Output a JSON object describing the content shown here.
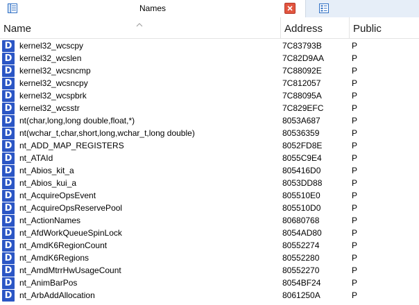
{
  "window": {
    "title": "Names"
  },
  "columns": {
    "name": "Name",
    "address": "Address",
    "public": "Public"
  },
  "icons": {
    "row_icon_letter": "D",
    "row_icon_color": "#2b56c5",
    "close_color": "#e2553f"
  },
  "rows": [
    {
      "name": "kernel32_wcscpy",
      "address": "7C83793B",
      "public": "P"
    },
    {
      "name": "kernel32_wcslen",
      "address": "7C82D9AA",
      "public": "P"
    },
    {
      "name": "kernel32_wcsncmp",
      "address": "7C88092E",
      "public": "P"
    },
    {
      "name": "kernel32_wcsncpy",
      "address": "7C812057",
      "public": "P"
    },
    {
      "name": "kernel32_wcspbrk",
      "address": "7C88095A",
      "public": "P"
    },
    {
      "name": "kernel32_wcsstr",
      "address": "7C829EFC",
      "public": "P"
    },
    {
      "name": "nt(char,long,long double,float,*)",
      "address": "8053A687",
      "public": "P"
    },
    {
      "name": "nt(wchar_t,char,short,long,wchar_t,long double)",
      "address": "80536359",
      "public": "P"
    },
    {
      "name": "nt_ADD_MAP_REGISTERS",
      "address": "8052FD8E",
      "public": "P"
    },
    {
      "name": "nt_ATAId",
      "address": "8055C9E4",
      "public": "P"
    },
    {
      "name": "nt_Abios_kit_a",
      "address": "805416D0",
      "public": "P"
    },
    {
      "name": "nt_Abios_kui_a",
      "address": "8053DD88",
      "public": "P"
    },
    {
      "name": "nt_AcquireOpsEvent",
      "address": "805510E0",
      "public": "P"
    },
    {
      "name": "nt_AcquireOpsReservePool",
      "address": "805510D0",
      "public": "P"
    },
    {
      "name": "nt_ActionNames",
      "address": "80680768",
      "public": "P"
    },
    {
      "name": "nt_AfdWorkQueueSpinLock",
      "address": "8054AD80",
      "public": "P"
    },
    {
      "name": "nt_AmdK6RegionCount",
      "address": "80552274",
      "public": "P"
    },
    {
      "name": "nt_AmdK6Regions",
      "address": "80552280",
      "public": "P"
    },
    {
      "name": "nt_AmdMtrrHwUsageCount",
      "address": "80552270",
      "public": "P"
    },
    {
      "name": "nt_AnimBarPos",
      "address": "8054BF24",
      "public": "P"
    },
    {
      "name": "nt_ArbAddAllocation",
      "address": "8061250A",
      "public": "P"
    }
  ]
}
